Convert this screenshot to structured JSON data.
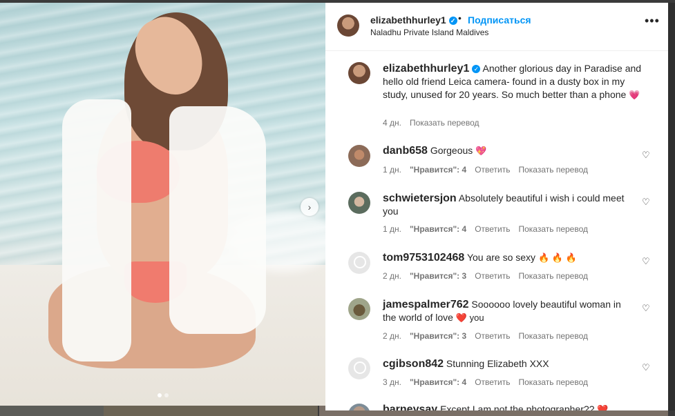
{
  "post": {
    "username": "elizabethhurley1",
    "follow_label": "Подписаться",
    "separator": "•",
    "location": "Naladhu Private Island Maldives",
    "more_label": "•••",
    "caption": "Another glorious day in Paradise and hello old friend Leica camera- found in a dusty box in my study, unused for 20 years. So much better than a phone",
    "caption_emoji": "💗",
    "caption_time": "4 дн.",
    "caption_translate": "Показать перевод",
    "next_label": "›"
  },
  "comments": [
    {
      "username": "danb658",
      "text": "Gorgeous",
      "emoji": "💖",
      "time": "1 дн.",
      "likes": "\"Нравится\": 4",
      "reply": "Ответить",
      "translate": "Показать перевод"
    },
    {
      "username": "schwietersjon",
      "text": "Absolutely beautiful i wish i could meet you",
      "emoji": "",
      "time": "1 дн.",
      "likes": "\"Нравится\": 4",
      "reply": "Ответить",
      "translate": "Показать перевод"
    },
    {
      "username": "tom9753102468",
      "text": "You are so sexy",
      "emoji": "🔥 🔥 🔥",
      "time": "2 дн.",
      "likes": "\"Нравится\": 3",
      "reply": "Ответить",
      "translate": "Показать перевод"
    },
    {
      "username": "jamespalmer762",
      "text": "Soooooo lovely beautiful woman in the world of love",
      "emoji": "❤️ you",
      "time": "2 дн.",
      "likes": "\"Нравится\": 3",
      "reply": "Ответить",
      "translate": "Показать перевод"
    },
    {
      "username": "cgibson842",
      "text": "Stunning Elizabeth XXX",
      "emoji": "",
      "time": "3 дн.",
      "likes": "\"Нравится\": 4",
      "reply": "Ответить",
      "translate": "Показать перевод"
    },
    {
      "username": "barneysay",
      "text": "Except I am not the photographer??",
      "emoji": "❤️",
      "time": "",
      "likes": "",
      "reply": "",
      "translate": ""
    }
  ],
  "icons": {
    "heart": "♡",
    "verified": "✓"
  },
  "colors": {
    "accent": "#0095f6",
    "text": "#262626",
    "muted": "#737373"
  }
}
